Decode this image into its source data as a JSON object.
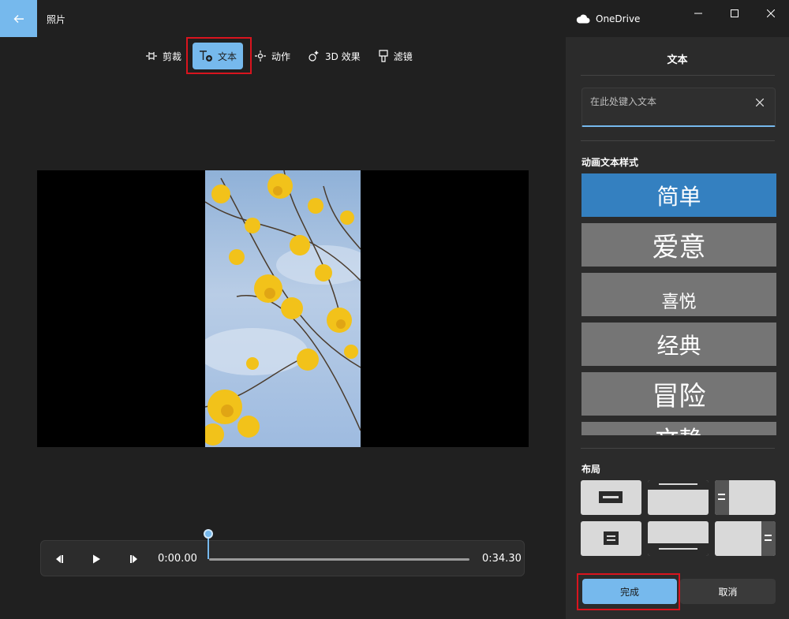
{
  "titlebar": {
    "app_title": "照片",
    "onedrive_label": "OneDrive"
  },
  "toolbar": {
    "tools": [
      {
        "label": "剪裁",
        "icon": "crop-icon"
      },
      {
        "label": "文本",
        "icon": "text-icon"
      },
      {
        "label": "动作",
        "icon": "motion-icon"
      },
      {
        "label": "3D 效果",
        "icon": "3d-effects-icon"
      },
      {
        "label": "滤镜",
        "icon": "filters-icon"
      }
    ],
    "active_tool": "文本"
  },
  "playback": {
    "current_time": "0:00.00",
    "total_time": "0:34.30",
    "progress": 0
  },
  "panel": {
    "title": "文本",
    "input_placeholder": "在此处键入文本",
    "styles_label": "动画文本样式",
    "styles": [
      "简单",
      "爱意",
      "喜悦",
      "经典",
      "冒险",
      "文静"
    ],
    "selected_style": "简单",
    "layout_label": "布局",
    "done_label": "完成",
    "cancel_label": "取消"
  },
  "colors": {
    "accent": "#76b9ed",
    "selected_style": "#3480c0",
    "highlight_box": "#d9141e",
    "panel_bg": "#2b2b2b",
    "app_bg": "#202020"
  }
}
